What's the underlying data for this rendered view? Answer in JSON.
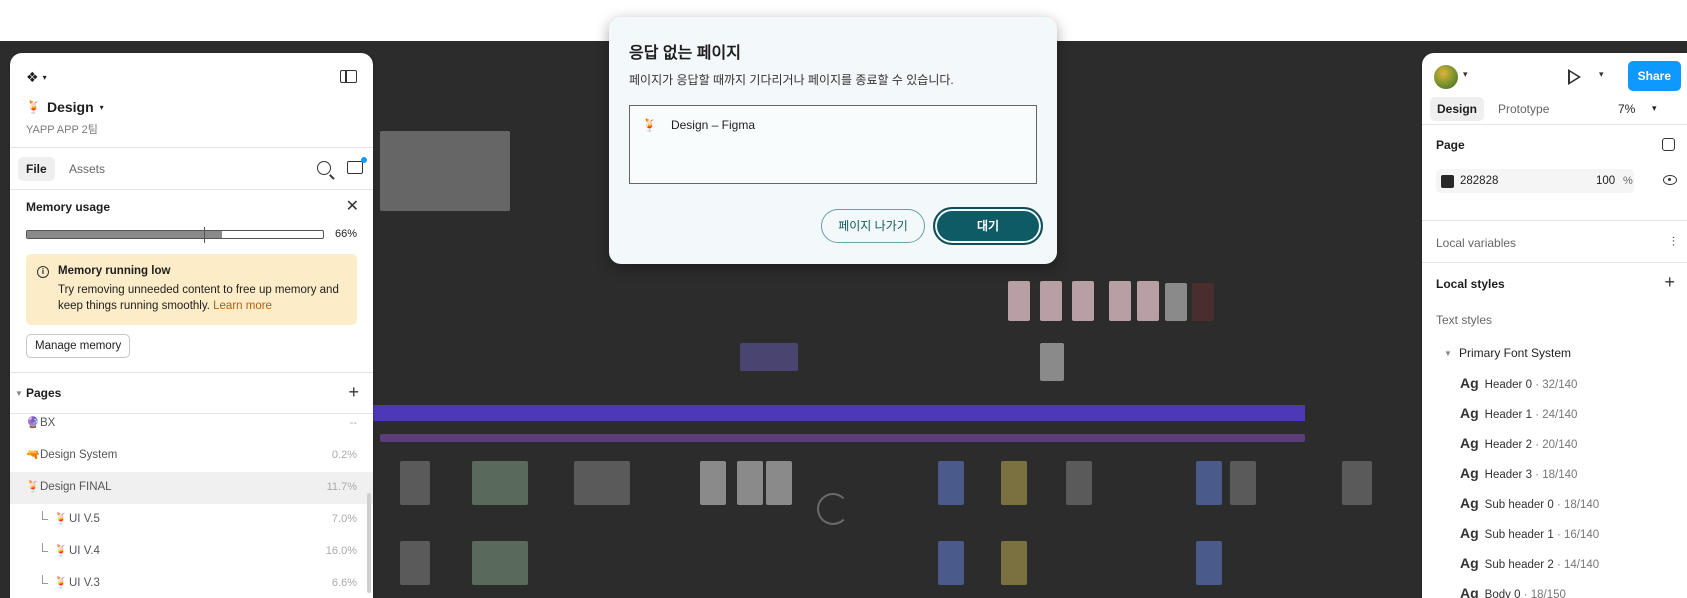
{
  "dialog": {
    "title": "응답 없는 페이지",
    "message": "페이지가 응답할 때까지 기다리거나 페이지를 종료할 수 있습니다.",
    "list_item_icon": "🍹",
    "list_item": "Design – Figma",
    "exit_label": "페이지 나가기",
    "wait_label": "대기"
  },
  "left_panel": {
    "file_icon": "🍹",
    "file_title": "Design",
    "file_subtitle": "YAPP APP 2팀",
    "tabs": {
      "file": "File",
      "assets": "Assets"
    },
    "memory": {
      "title": "Memory usage",
      "percent_label": "66%",
      "percent_value": 66,
      "warning_title": "Memory running low",
      "warning_text": "Try removing unneeded content to free up memory and keep things running smoothly.",
      "warning_link": "Learn more",
      "manage_label": "Manage memory"
    },
    "pages": {
      "title": "Pages",
      "items": [
        {
          "icon": "🔮",
          "name": "BX",
          "percent": "--"
        },
        {
          "icon": "🔫",
          "name": "Design System",
          "percent": "0.2%"
        },
        {
          "icon": "🍹",
          "name": "Design FINAL",
          "percent": "11.7%"
        },
        {
          "icon": "🍹",
          "name": "UI V.5",
          "percent": "7.0%"
        },
        {
          "icon": "🍹",
          "name": "UI V.4",
          "percent": "16.0%"
        },
        {
          "icon": "🍹",
          "name": "UI V.3",
          "percent": "6.6%"
        }
      ]
    }
  },
  "right_panel": {
    "share_label": "Share",
    "tabs": {
      "design": "Design",
      "prototype": "Prototype"
    },
    "zoom": "7%",
    "page": {
      "title": "Page",
      "color_hex": "282828",
      "opacity": "100",
      "opacity_unit": "%"
    },
    "local_variables": "Local variables",
    "local_styles": "Local styles",
    "text_styles": "Text styles",
    "font_system": "Primary Font System",
    "style_glyph": "Ag",
    "styles": [
      {
        "name": "Header 0",
        "spec": "· 32/140"
      },
      {
        "name": "Header 1",
        "spec": "· 24/140"
      },
      {
        "name": "Header 2",
        "spec": "· 20/140"
      },
      {
        "name": "Header 3",
        "spec": "· 18/140"
      },
      {
        "name": "Sub header 0",
        "spec": "· 18/140"
      },
      {
        "name": "Sub header 1",
        "spec": "· 16/140"
      },
      {
        "name": "Sub header 2",
        "spec": "· 14/140"
      },
      {
        "name": "Body 0",
        "spec": "· 18/150"
      }
    ]
  },
  "colors": {
    "canvas_bg": "#282828",
    "accent": "#0d99ff",
    "dialog_primary": "#0e5b66",
    "warning_bg": "#fdecc8"
  }
}
